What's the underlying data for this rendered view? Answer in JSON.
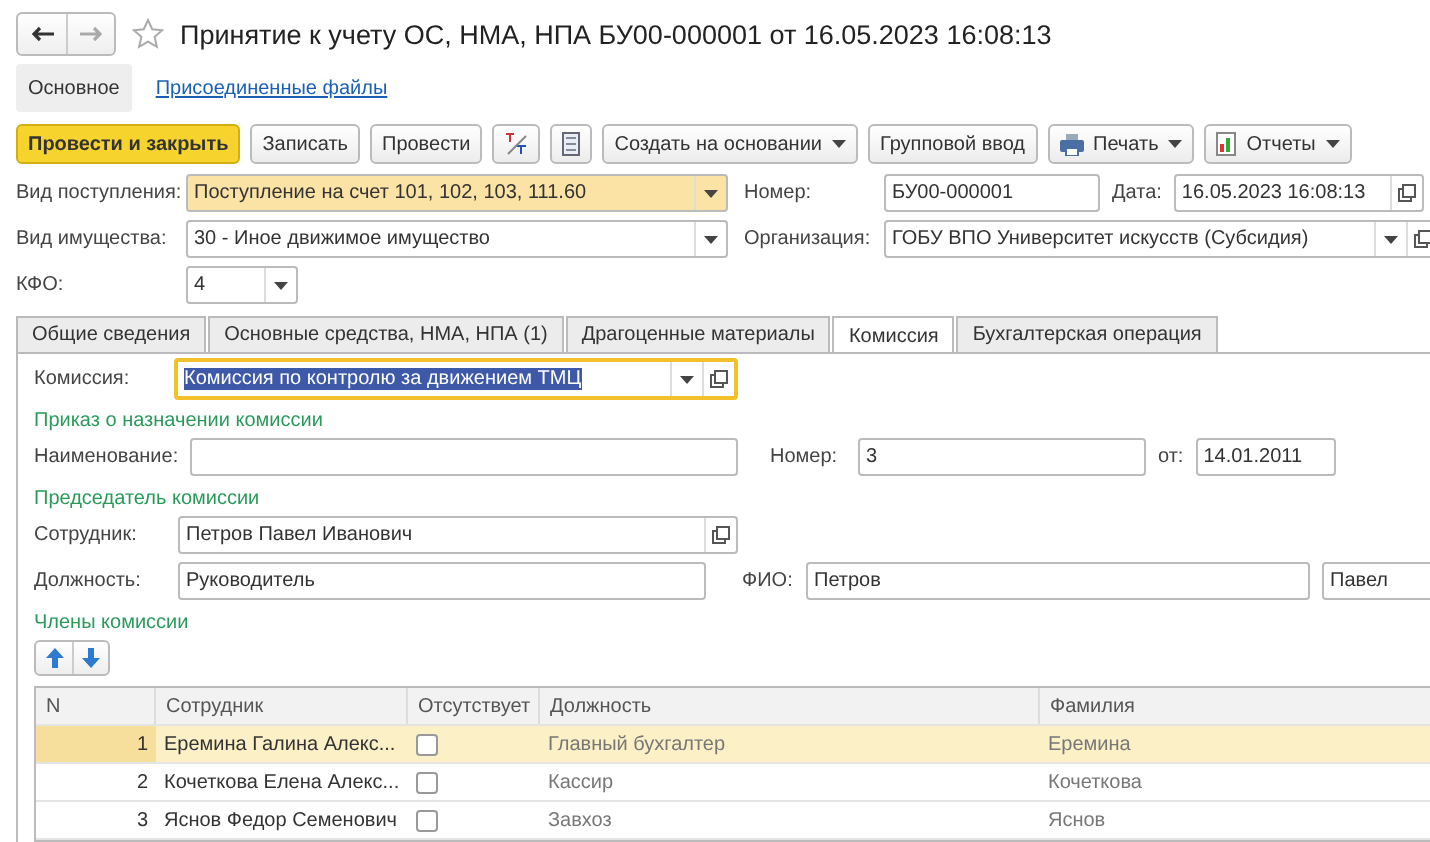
{
  "window": {
    "title": "Принятие к учету ОС, НМА, НПА БУ00-000001 от 16.05.2023 16:08:13",
    "favorite": false
  },
  "sections": [
    {
      "label": "Основное",
      "selected": true
    },
    {
      "label": "Присоединенные файлы",
      "selected": false
    }
  ],
  "toolbar": [
    {
      "kind": "primary",
      "label": "Провести и закрыть"
    },
    {
      "kind": "plain",
      "label": "Записать"
    },
    {
      "kind": "plain",
      "label": "Провести"
    },
    {
      "kind": "icon"
    },
    {
      "kind": "icon"
    },
    {
      "kind": "dropdown",
      "label": "Создать на основании"
    },
    {
      "kind": "plain",
      "label": "Групповой ввод"
    },
    {
      "kind": "dropdown",
      "label": "Печать"
    },
    {
      "kind": "dropdown",
      "label": "Отчеты"
    }
  ],
  "header": {
    "receipt_type": {
      "label": "Вид поступления:",
      "value": "Поступление на счет 101, 102, 103, 111.60",
      "highlighted": true
    },
    "number": {
      "label": "Номер:",
      "value": "БУ00-000001"
    },
    "date": {
      "label": "Дата:",
      "value": "16.05.2023 16:08:13"
    },
    "property_type": {
      "label": "Вид имущества:",
      "value": "30 - Иное движимое имущество",
      "highlighted": false
    },
    "organization": {
      "label": "Организация:",
      "value": "ГОБУ ВПО Университет искусств (Субсидия)"
    },
    "kfo": {
      "label": "КФО:",
      "value": "4"
    }
  },
  "tabs": [
    {
      "label": "Общие сведения",
      "selected": false
    },
    {
      "label": "Основные средства, НМА, НПА (1)",
      "selected": false
    },
    {
      "label": "Драгоценные материалы",
      "selected": false
    },
    {
      "label": "Комиссия",
      "selected": true
    },
    {
      "label": "Бухгалтерская операция",
      "selected": false
    }
  ],
  "commission": {
    "label": "Комиссия:",
    "value": "Комиссия по контролю за движением ТМЦ",
    "focused": true
  },
  "order": {
    "heading": "Приказ о назначении комиссии",
    "name": {
      "label": "Наименование:"
    },
    "number": {
      "label": "Номер:",
      "value": "3"
    },
    "date": {
      "label": "от:",
      "value": "14.01.2011"
    }
  },
  "chairman": {
    "heading": "Председатель комиссии",
    "employee": {
      "label": "Сотрудник:",
      "value": "Петров Павел Иванович"
    },
    "position": {
      "label": "Должность:",
      "value": "Руководитель"
    },
    "full_name": {
      "label": "ФИО:",
      "values": [
        "Петров",
        "Павел"
      ]
    }
  },
  "members": {
    "heading": "Члены комиссии",
    "columns": [
      "N",
      "Сотрудник",
      "Отсутствует",
      "Должность",
      "Фамилия"
    ],
    "rows": [
      {
        "n": "1",
        "employee": "Еремина Галина Алекс...",
        "absent": false,
        "position": "Главный бухгалтер",
        "surname": "Еремина",
        "selected": true
      },
      {
        "n": "2",
        "employee": "Кочеткова Елена Алекс...",
        "absent": false,
        "position": "Кассир",
        "surname": "Кочеткова",
        "selected": false
      },
      {
        "n": "3",
        "employee": "Яснов Федор Семенович",
        "absent": false,
        "position": "Завхоз",
        "surname": "Яснов",
        "selected": false
      }
    ]
  }
}
